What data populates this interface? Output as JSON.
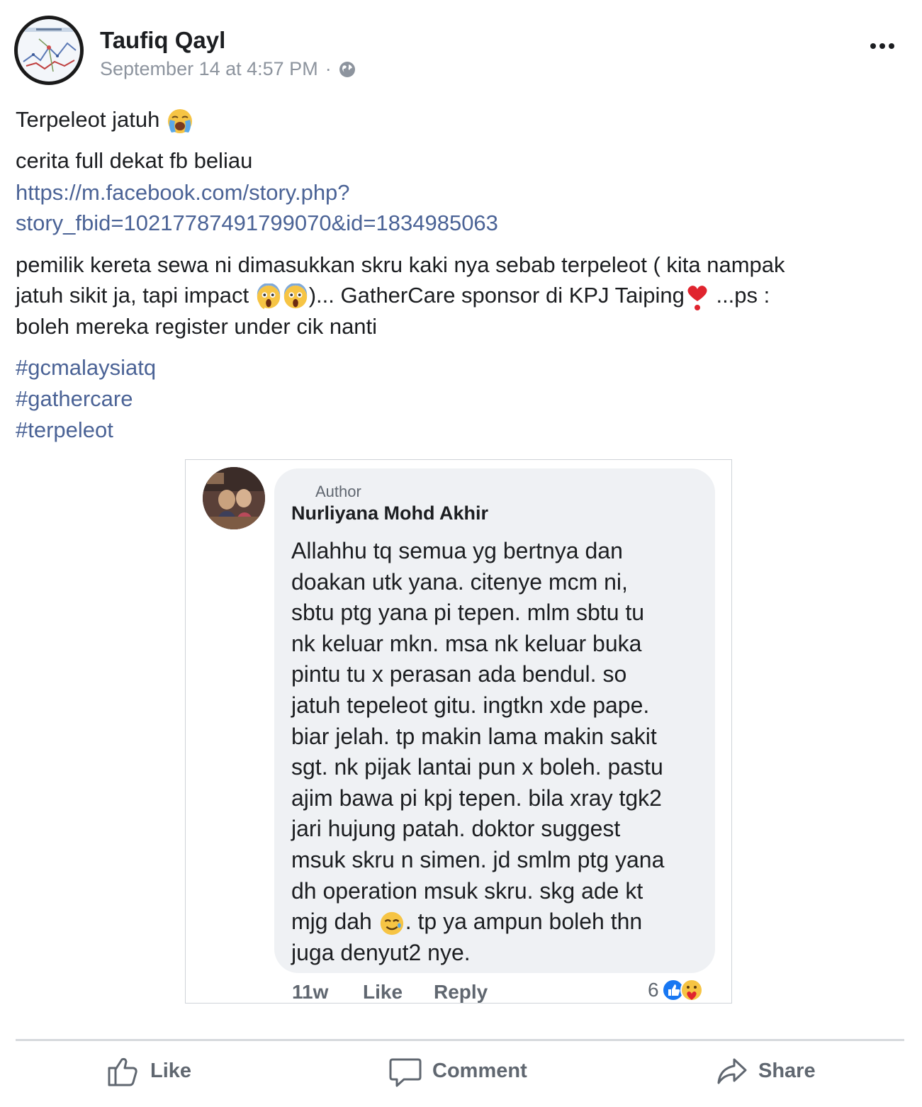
{
  "post": {
    "author": "Taufiq Qayl",
    "timestamp": "September 14 at 4:57 PM",
    "separator": "·",
    "privacy_icon": "globe-icon",
    "line1": "Terpeleot jatuh",
    "line2": "cerita full dekat fb beliau",
    "link_line1": "https://m.facebook.com/story.php?",
    "link_line2": "story_fbid=10217787491799070&id=1834985063",
    "para_l1": "pemilik kereta sewa ni dimasukkan skru kaki nya sebab terpeleot ( kita nampak",
    "para_l2a": "jatuh sikit ja, tapi impact ",
    "para_l2b": ")... GatherCare sponsor di KPJ Taiping",
    "para_l2c": " ...ps :",
    "para_l3": "boleh mereka register under cik nanti",
    "hashtags": [
      "#gcmalaysiatq",
      "#gathercare",
      "#terpeleot"
    ]
  },
  "comment": {
    "badge": "Author",
    "name": "Nurliyana Mohd Akhir",
    "lines": [
      "Allahhu tq semua yg bertnya dan",
      "doakan utk yana. citenye mcm ni,",
      "sbtu ptg yana pi tepen. mlm sbtu tu",
      "nk keluar mkn. msa nk keluar buka",
      "pintu tu x perasan ada bendul. so",
      "jatuh tepeleot gitu. ingtkn xde pape.",
      "biar jelah. tp makin lama makin sakit",
      "sgt. nk pijak lantai pun x boleh. pastu",
      "ajim bawa pi kpj tepen. bila xray tgk2",
      "jari hujung patah. doktor suggest",
      "msuk skru n simen. jd smlm ptg yana",
      "dh operation msuk skru. skg ade kt"
    ],
    "line13a": "mjg dah ",
    "line13b": ". tp ya ampun boleh thn",
    "line14": "juga denyut2 nye.",
    "age": "11w",
    "like": "Like",
    "reply": "Reply",
    "reaction_count": "6"
  },
  "actions": {
    "like": "Like",
    "comment": "Comment",
    "share": "Share"
  },
  "colors": {
    "link": "#4b6396",
    "muted": "#606770",
    "bubble": "#eff1f4",
    "like_blue": "#1877f2"
  }
}
